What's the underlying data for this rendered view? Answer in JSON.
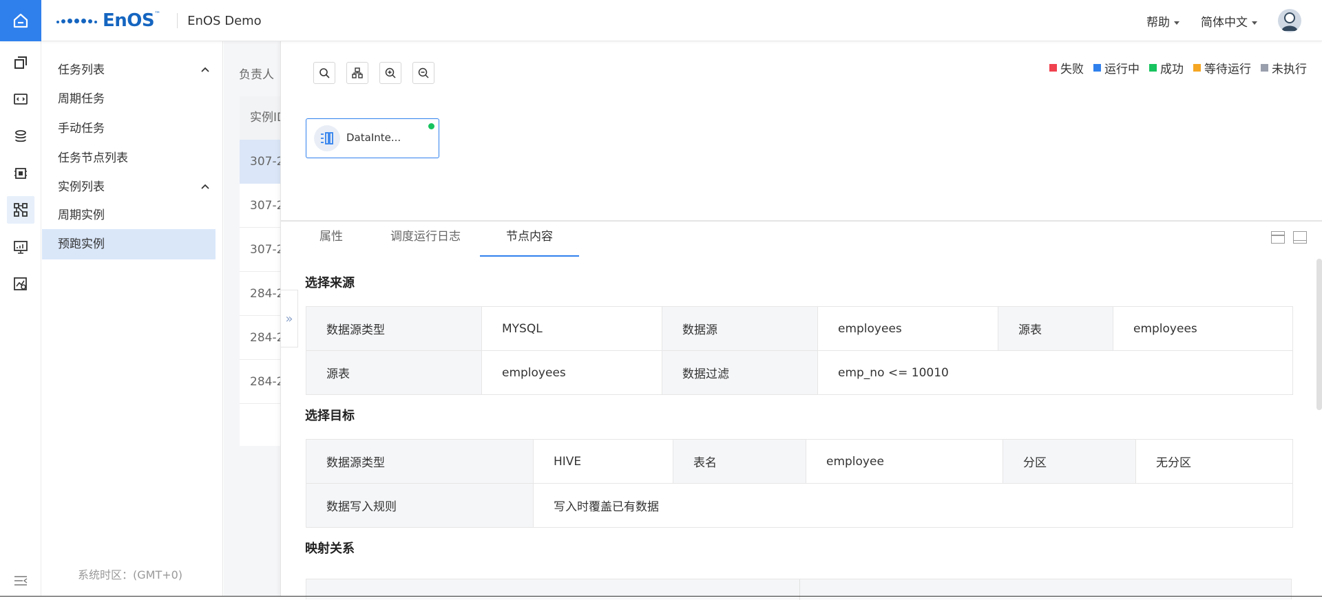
{
  "topbar": {
    "brand": "EnOS",
    "brand_tm": "™",
    "org_name": "EnOS Demo",
    "help": "帮助",
    "language": "简体中文"
  },
  "icon_rail": {
    "items": [
      "home-icon",
      "instances-icon",
      "code-task-icon",
      "workflow-icon",
      "chip-icon",
      "operations-icon",
      "monitor-icon",
      "chart-search-icon"
    ],
    "active": "operations-icon"
  },
  "sidebar": {
    "groups": [
      {
        "label": "任务列表",
        "items": [
          "周期任务",
          "手动任务",
          "任务节点列表"
        ]
      },
      {
        "label": "实例列表",
        "items": [
          "周期实例",
          "预跑实例"
        ]
      }
    ],
    "selected": "预跑实例",
    "timezone": "系统时区：(GMT+0)"
  },
  "list_panel": {
    "filter_label": "负责人",
    "column_header": "实例ID",
    "rows": [
      "307-2",
      "307-2",
      "307-2",
      "284-2",
      "284-2",
      "284-2"
    ]
  },
  "dag": {
    "toolbar": [
      "search-icon",
      "layout-icon",
      "zoom-in-icon",
      "zoom-out-icon"
    ],
    "legend": [
      {
        "label": "失败",
        "color": "#f0414f"
      },
      {
        "label": "运行中",
        "color": "#2f80ed"
      },
      {
        "label": "成功",
        "color": "#17c35e"
      },
      {
        "label": "等待运行",
        "color": "#f5a623"
      },
      {
        "label": "未执行",
        "color": "#9a9fad"
      }
    ],
    "node": {
      "label": "DataInte...",
      "status_color": "#17c35e"
    }
  },
  "detail_tabs": {
    "tabs": [
      "属性",
      "调度运行日志",
      "节点内容"
    ],
    "active": "节点内容"
  },
  "source": {
    "title": "选择来源",
    "row1": [
      {
        "k": "数据源类型",
        "v": "MYSQL"
      },
      {
        "k": "数据源",
        "v": "employees"
      },
      {
        "k": "源表",
        "v": "employees"
      }
    ],
    "row2": [
      {
        "k": "源表",
        "v": "employees"
      },
      {
        "k": "数据过滤",
        "v": "emp_no <= 10010"
      }
    ]
  },
  "target": {
    "title": "选择目标",
    "row1": [
      {
        "k": "数据源类型",
        "v": "HIVE"
      },
      {
        "k": "表名",
        "v": "employee"
      },
      {
        "k": "分区",
        "v": "无分区"
      }
    ],
    "row2": [
      {
        "k": "数据写入规则",
        "v": "写入时覆盖已有数据"
      }
    ]
  },
  "mapping": {
    "title": "映射关系"
  }
}
